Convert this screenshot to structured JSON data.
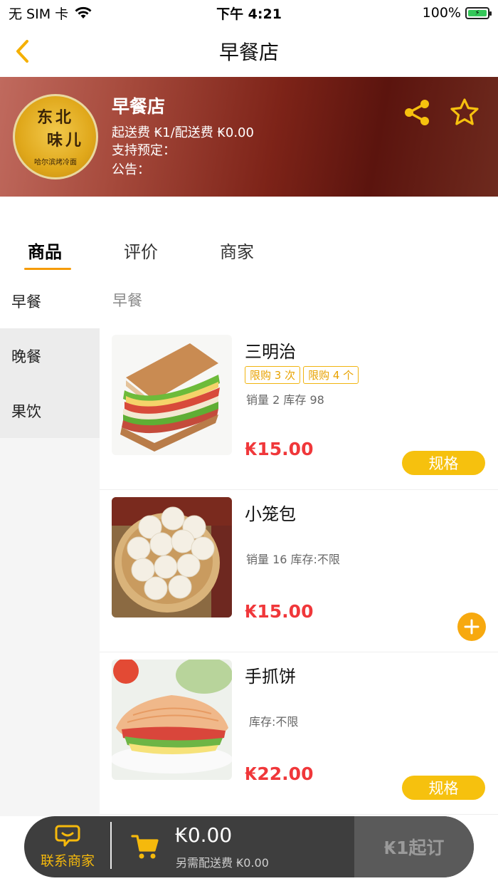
{
  "status_bar": {
    "carrier": "无 SIM 卡",
    "time": "下午 4:21",
    "battery": "100%"
  },
  "nav": {
    "title": "早餐店"
  },
  "shop": {
    "name": "早餐店",
    "fee_line": "起送费 ₭1/配送费 ₭0.00",
    "reserve_line": "支持预定：",
    "notice_line": "公告：",
    "logo_line1": "东北",
    "logo_line2": "味儿",
    "logo_line3": "哈尔滨烤冷面"
  },
  "tabs": [
    {
      "label": "商品",
      "active": true
    },
    {
      "label": "评价",
      "active": false
    },
    {
      "label": "商家",
      "active": false
    }
  ],
  "sidebar": {
    "items": [
      {
        "label": "早餐",
        "active": true
      },
      {
        "label": "晚餐",
        "active": false
      },
      {
        "label": "果饮",
        "active": false
      }
    ]
  },
  "category_title": "早餐",
  "products": [
    {
      "name": "三明治",
      "tags": [
        "限购 3 次",
        "限购 4 个"
      ],
      "meta": "销量 2 库存 98",
      "price": "₭15.00",
      "action": "规格",
      "image": "sandwich-image"
    },
    {
      "name": "小笼包",
      "tags": [],
      "meta": "销量 16 库存:不限",
      "price": "₭15.00",
      "action": "+",
      "image": "steamed-buns-image"
    },
    {
      "name": "手抓饼",
      "tags": [],
      "meta": "库存:不限",
      "price": "₭22.00",
      "action": "规格",
      "image": "pancake-image"
    }
  ],
  "cart": {
    "contact_label": "联系商家",
    "total": "₭0.00",
    "delivery_note": "另需配送费 ₭0.00",
    "checkout_label": "₭1起订"
  },
  "colors": {
    "accent": "#f6c10e",
    "price": "#f0373a",
    "tab_underline": "#f59b06"
  }
}
